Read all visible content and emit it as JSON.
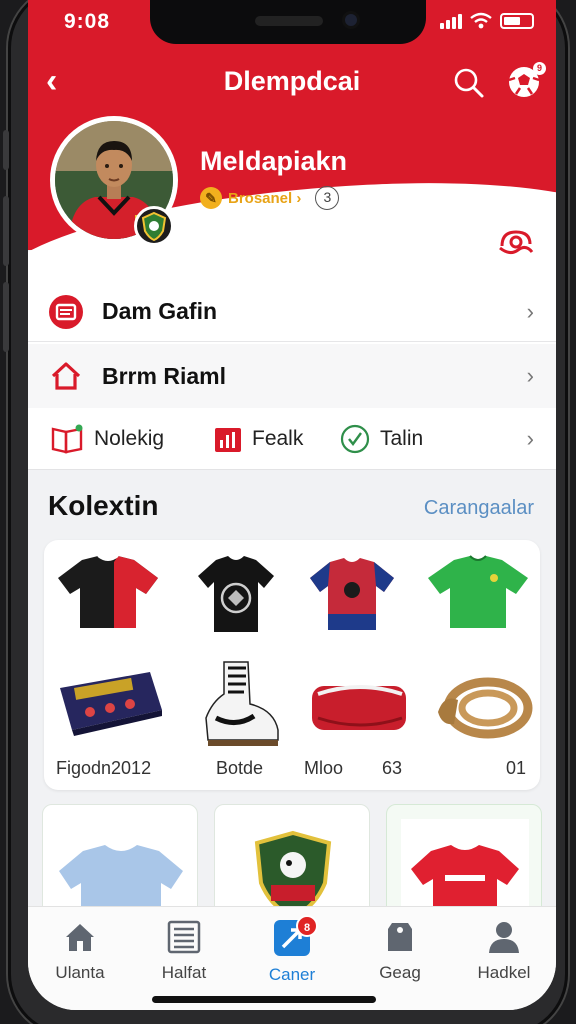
{
  "status": {
    "time": "9:08"
  },
  "nav": {
    "title": "Dlempdcai",
    "ball_badge": "9"
  },
  "profile": {
    "name": "Meldapiakn",
    "level_label": "Brosanel ›",
    "level_count": "3"
  },
  "menu": {
    "row1_label": "Dam Gafin",
    "row2_label": "Brrm Riaml",
    "quick": [
      {
        "label": "Nolekig"
      },
      {
        "label": "Fealk"
      },
      {
        "label": "Talin"
      }
    ]
  },
  "collection": {
    "title": "Kolextin",
    "link": "Carangaalar",
    "captions": [
      "Figodn2012",
      "Botde",
      "Mloo",
      "63",
      "01"
    ]
  },
  "tabbar": {
    "tabs": [
      {
        "label": "Ulanta"
      },
      {
        "label": "Halfat"
      },
      {
        "label": "Caner",
        "badge": "8"
      },
      {
        "label": "Geag"
      },
      {
        "label": "Hadkel"
      }
    ]
  },
  "colors": {
    "brand_red": "#d91a2a",
    "accent_blue": "#1e7fd6",
    "link_blue": "#5b8fc3"
  }
}
